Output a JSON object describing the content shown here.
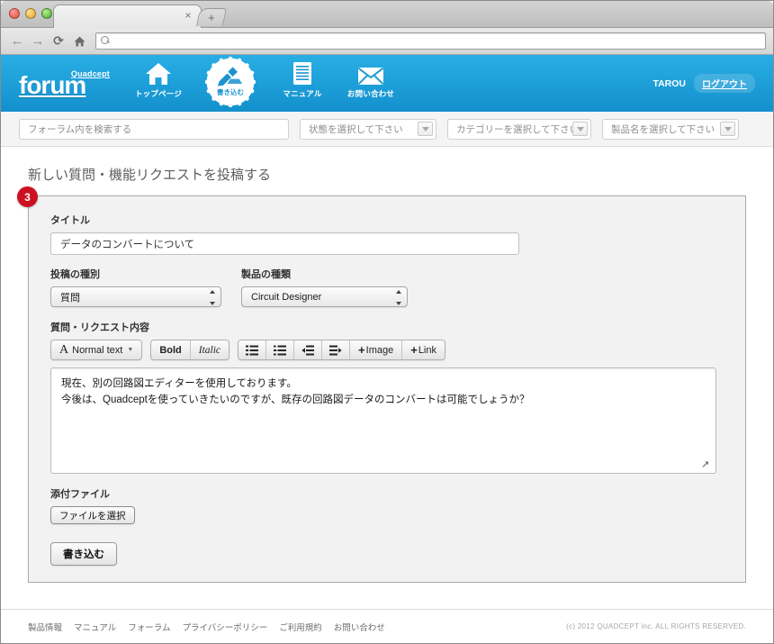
{
  "browser": {
    "tab_close_label": "×",
    "newtab_label": "+",
    "back_icon": "←",
    "forward_icon": "→",
    "reload_icon": "⟳",
    "home_icon": "⌂",
    "address_value": "",
    "address_placeholder": ""
  },
  "header": {
    "logo_sub": "Quadcept",
    "logo_main": "forum",
    "nav": [
      {
        "label": "トップページ",
        "icon": "home-icon"
      },
      {
        "label": "書き込む",
        "icon": "write-icon",
        "active": true
      },
      {
        "label": "マニュアル",
        "icon": "document-icon"
      },
      {
        "label": "お問い合わせ",
        "icon": "mail-icon"
      }
    ],
    "user_name": "TAROU",
    "logout_label": "ログアウト"
  },
  "filterbar": {
    "search_placeholder": "フォーラム内を検索する",
    "search_value": "",
    "selects": [
      {
        "label": "状態を選択して下さい"
      },
      {
        "label": "カテゴリーを選択して下さい"
      },
      {
        "label": "製品名を選択して下さい"
      }
    ]
  },
  "main": {
    "page_title": "新しい質問・機能リクエストを投稿する",
    "step_badge": "3",
    "title_label": "タイトル",
    "title_value": "データのコンバートについて",
    "post_type_label": "投稿の種別",
    "post_type_value": "質問",
    "product_type_label": "製品の種類",
    "product_type_value": "Circuit Designer",
    "content_label": "質問・リクエスト内容",
    "toolbar": {
      "style_label": "Normal text",
      "style_glyph": "A",
      "bold_label": "Bold",
      "italic_label": "Italic",
      "bullet_list": "bulleted-list-icon",
      "number_list": "numbered-list-icon",
      "outdent": "outdent-icon",
      "indent": "indent-icon",
      "image_label": "Image",
      "link_label": "Link",
      "plus": "+"
    },
    "content_line1": "現在、別の回路図エディターを使用しております。",
    "content_line2": "今後は、Quadceptを使っていきたいのですが、既存の回路図データのコンバートは可能でしょうか？",
    "attach_label": "添付ファイル",
    "file_button": "ファイルを選択",
    "submit_button": "書き込む"
  },
  "footer": {
    "links": [
      "製品情報",
      "マニュアル",
      "フォーラム",
      "プライバシーポリシー",
      "ご利用規約",
      "お問い合わせ"
    ],
    "copyright": "(c) 2012 QUADCEPT inc. ALL RIGHTS RESERVED."
  },
  "colors": {
    "brand_blue": "#1390cd",
    "badge_red": "#cc1122",
    "panel_bg": "#f2f2f2"
  }
}
